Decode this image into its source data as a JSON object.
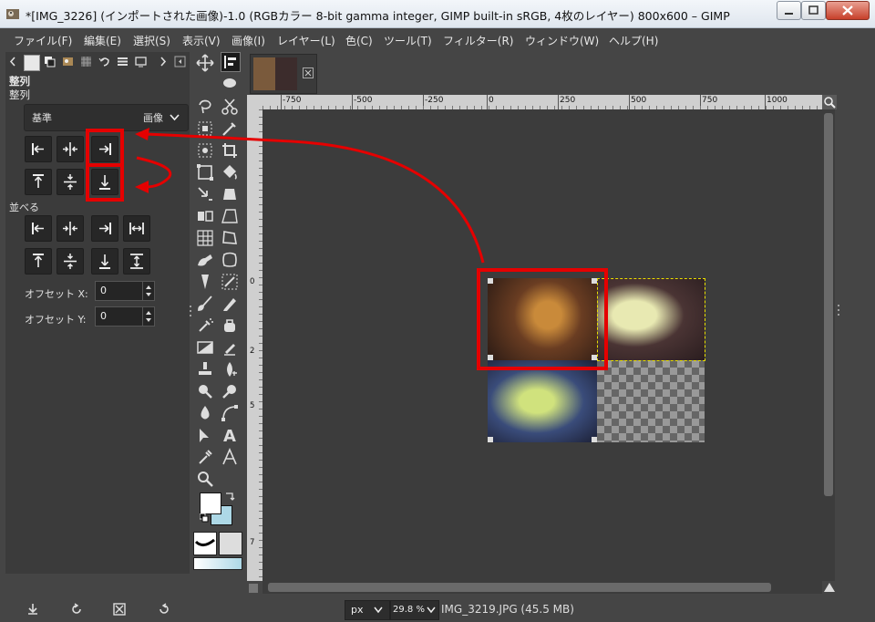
{
  "window": {
    "title": "*[IMG_3226] (インポートされた画像)-1.0 (RGBカラー 8-bit gamma integer, GIMP built-in sRGB, 4枚のレイヤー) 800x600 – GIMP"
  },
  "menu": [
    {
      "id": "file",
      "label": "ファイル(F)"
    },
    {
      "id": "edit",
      "label": "編集(E)"
    },
    {
      "id": "select",
      "label": "選択(S)"
    },
    {
      "id": "view",
      "label": "表示(V)"
    },
    {
      "id": "image",
      "label": "画像(I)"
    },
    {
      "id": "layer",
      "label": "レイヤー(L)"
    },
    {
      "id": "colors",
      "label": "色(C)"
    },
    {
      "id": "tools",
      "label": "ツール(T)"
    },
    {
      "id": "filters",
      "label": "フィルター(R)"
    },
    {
      "id": "windows",
      "label": "ウィンドウ(W)"
    },
    {
      "id": "help",
      "label": "ヘルプ(H)"
    }
  ],
  "align_panel": {
    "tab_title": "整列",
    "section_title": "整列",
    "relative_label": "基準",
    "relative_value": "画像",
    "distribute_label": "並べる",
    "offset_x_label": "オフセット X:",
    "offset_x_value": "0",
    "offset_y_label": "オフセット Y:",
    "offset_y_value": "0"
  },
  "ruler": {
    "top_labels": [
      "-750",
      "-500",
      "-250",
      "0",
      "250",
      "500",
      "750",
      "1000"
    ],
    "left_labels": [
      "0",
      "2",
      "5",
      "7"
    ]
  },
  "status": {
    "unit": "px",
    "zoom": "29.8 %",
    "file_info": "IMG_3219.JPG (45.5 MB)"
  },
  "colors": {
    "highlight_red": "#e50000",
    "foreground": "#ffffff",
    "background": "#add8e6"
  }
}
